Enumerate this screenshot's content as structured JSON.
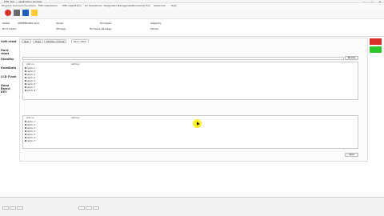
{
  "window": {
    "title": "MTK Tool — application window",
    "min": "—",
    "max": "▢",
    "close": "✕"
  },
  "menu": {
    "items": [
      "Program",
      "Common Functions",
      "MTK Operations",
      "MTK Operations",
      "Qc Operations",
      "Diagnostic Management",
      "Unlocking Tool",
      "Advanced",
      "Help"
    ]
  },
  "toolbar": {
    "items": [
      {
        "label": "",
        "icon": "power-icon",
        "color": "#d9302c"
      },
      {
        "label": "",
        "icon": "user-icon",
        "color": "#6a6a6a"
      },
      {
        "label": "",
        "icon": "phone-icon",
        "color": "#1d5fb8"
      },
      {
        "label": "",
        "icon": "gear-icon",
        "color": "#ffcc33"
      }
    ]
  },
  "info": {
    "model_label": "Model:",
    "model_value": "SOMEMODEL.OLD",
    "serial_label": "Serial:",
    "serial_value": "",
    "firmware_label": "Firmware:",
    "firmware_value": "",
    "capacity_label": "Capacity:",
    "capacity_value": "",
    "bootloader_label": "Boot loader:",
    "bootloader_value": "",
    "storage_label": "Storage:",
    "storage_value": "",
    "package_label": "Firmware Package:",
    "package_value": "",
    "family_label": "Family:",
    "family_value": ""
  },
  "sidebar": {
    "items": [
      "Soft reset",
      "Hard reset",
      "Standby",
      "ReadData",
      "LCD Flash",
      "Dead Board KEY"
    ]
  },
  "tabs": [
    {
      "label": "Main"
    },
    {
      "label": "Flash"
    },
    {
      "label": "Partition / Format"
    },
    {
      "label": "Read / Write"
    }
  ],
  "panel": {
    "path_value": "",
    "browse_label": "Browse",
    "top_list_headers": [
      "Options",
      "Settings"
    ],
    "top_list_rows": [
      "option 1",
      "option 2",
      "option 3",
      "option 4",
      "option 5",
      "option 6",
      "option 7",
      "option 8"
    ],
    "radio_a": "",
    "radio_b": "",
    "section_label": "",
    "bottom_list_headers": [
      "Options",
      "Settings"
    ],
    "bottom_list_rows": [
      "option 1",
      "option 2",
      "option 3",
      "option 4",
      "option 5",
      "option 6",
      "option 7"
    ],
    "bottom_value_text": "",
    "start_label": "Start"
  },
  "status": {
    "red_label": "",
    "green_label": ""
  },
  "bottom": {
    "log_title": "",
    "device_label": "",
    "usb_label": "",
    "com_label": "",
    "buttons": [
      "",
      "",
      "",
      "",
      "",
      ""
    ]
  },
  "colors": {
    "accent_red": "#d9302c",
    "accent_green": "#2ec62e",
    "highlight": "#ffeb00"
  }
}
